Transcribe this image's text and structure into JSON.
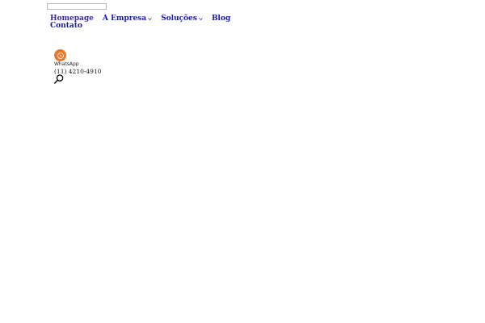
{
  "search": {
    "value": "",
    "placeholder": ""
  },
  "nav": {
    "items": [
      {
        "label": "Homepage",
        "has_dropdown": false,
        "active": true
      },
      {
        "label": "A Empresa",
        "has_dropdown": true
      },
      {
        "label": "Soluções",
        "has_dropdown": true
      },
      {
        "label": "Blog",
        "has_dropdown": false
      },
      {
        "label": "Contato",
        "has_dropdown": false
      }
    ],
    "dropdown_icon": "chevron-down-icon"
  },
  "contact": {
    "icon": "whatsapp-icon",
    "label": "WhatsApp",
    "phone": "(11) 4210-4910"
  },
  "search_button": {
    "icon": "search-icon"
  },
  "colors": {
    "nav_text": "#1a1aa6",
    "nav_active": "#3a2a9a",
    "whatsapp_badge": "#e8782a",
    "background": "#ffffff"
  }
}
